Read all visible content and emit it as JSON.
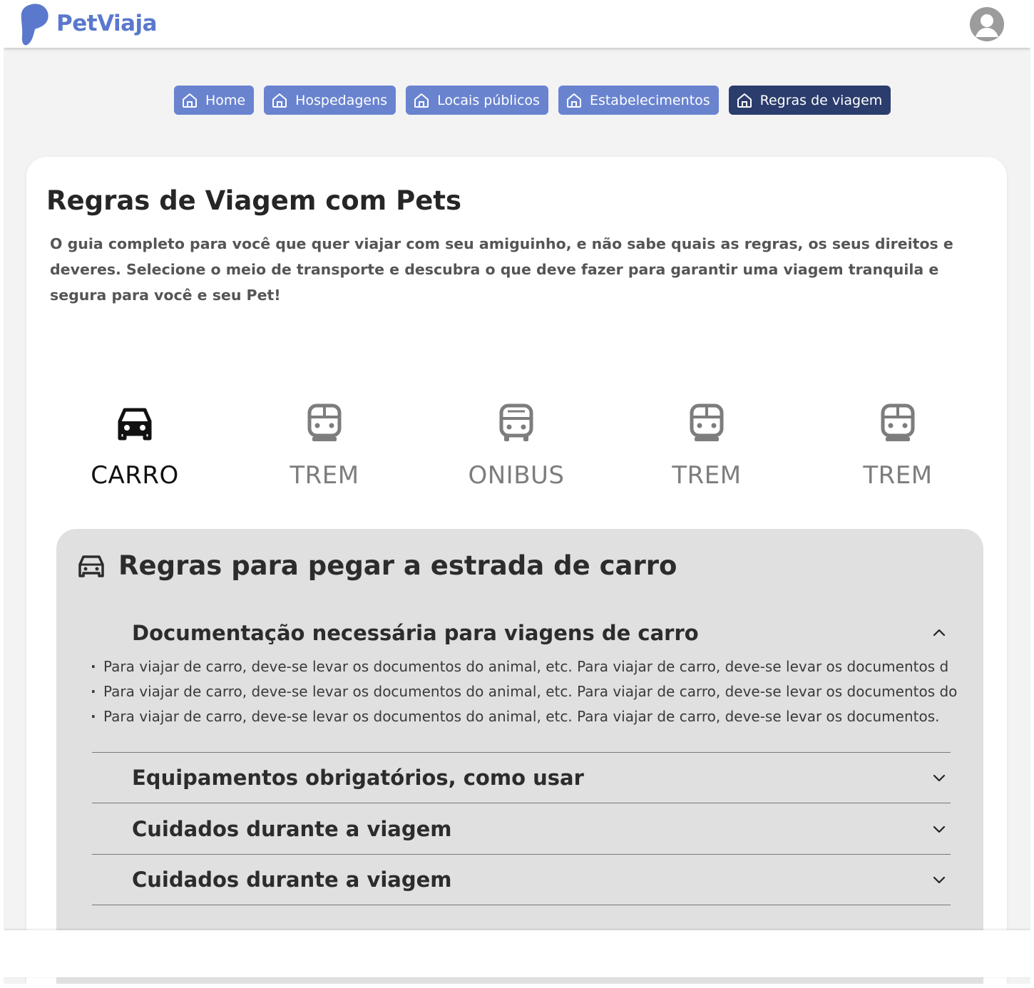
{
  "header": {
    "brand": "PetViaja",
    "brand_color": "#5a78cc"
  },
  "nav": {
    "items": [
      {
        "label": "Home",
        "icon": "home-icon"
      },
      {
        "label": "Hospedagens",
        "icon": "home-icon"
      },
      {
        "label": "Locais públicos",
        "icon": "home-icon"
      },
      {
        "label": "Estabelecimentos",
        "icon": "home-icon"
      },
      {
        "label": "Regras de viagem",
        "icon": "home-icon",
        "active": true
      }
    ],
    "color": "#6983cf",
    "active_color": "#2b3d6c"
  },
  "page": {
    "title": "Regras de Viagem com Pets",
    "description": "O guia completo para você que quer viajar com seu amiguinho, e não sabe quais as regras, os seus direitos e deveres. Selecione o meio de transporte e descubra o que deve fazer para garantir uma viagem tranquila e segura para você e seu Pet!"
  },
  "transport_tabs": [
    {
      "label": "CARRO",
      "icon": "car-icon",
      "active": true
    },
    {
      "label": "TREM",
      "icon": "train-icon"
    },
    {
      "label": "ONIBUS",
      "icon": "bus-icon"
    },
    {
      "label": "TREM",
      "icon": "train-icon"
    },
    {
      "label": "TREM",
      "icon": "train-icon"
    }
  ],
  "rules": {
    "title": "Regras para pegar a estrada de carro",
    "sections": [
      {
        "title": "Documentação necessária para viagens de carro",
        "expanded": true,
        "items": [
          "Para viajar de carro, deve-se levar os documentos do animal, etc. Para viajar de carro, deve-se levar os documentos d",
          "Para viajar de carro, deve-se levar os documentos do animal, etc. Para viajar de carro, deve-se levar os documentos do",
          "Para viajar de carro, deve-se levar os documentos do animal, etc. Para viajar de carro, deve-se levar os documentos."
        ]
      },
      {
        "title": "Equipamentos obrigatórios, como usar",
        "expanded": false
      },
      {
        "title": "Cuidados durante a viagem",
        "expanded": false
      },
      {
        "title": "Cuidados durante a viagem",
        "expanded": false
      }
    ]
  }
}
